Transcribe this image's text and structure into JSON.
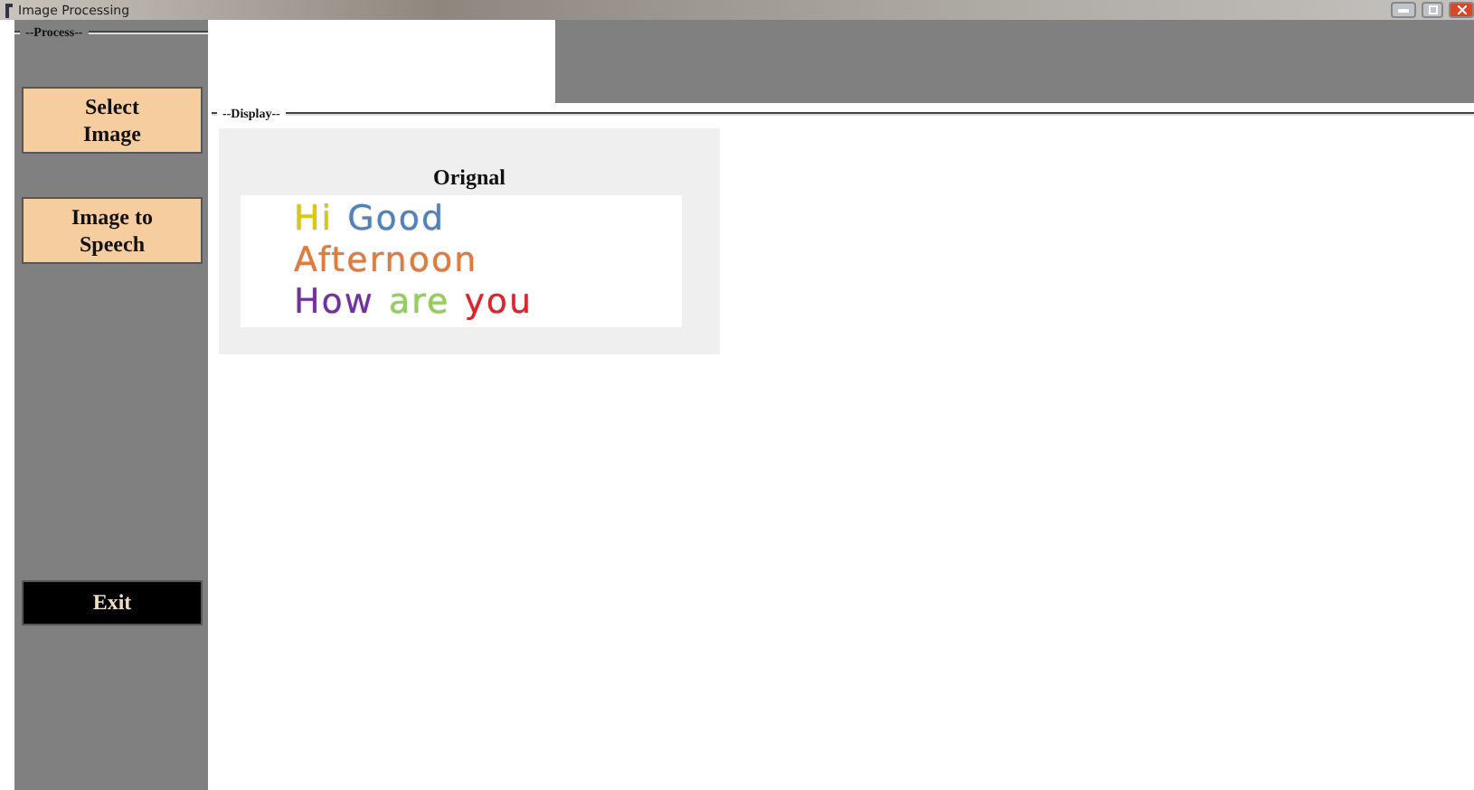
{
  "window": {
    "title": "Image Processing"
  },
  "process": {
    "legend": "--Process--",
    "buttons": [
      {
        "label": "Select Image",
        "kind": "action"
      },
      {
        "label": "Image to Speech",
        "kind": "action"
      },
      {
        "label": "Exit",
        "kind": "exit"
      }
    ]
  },
  "display": {
    "legend": "--Display--",
    "image_title": "Orignal",
    "image_lines": [
      [
        {
          "text": "Hi",
          "color": "#d8cc00"
        },
        {
          "text": "Good",
          "color": "#4f81bd"
        }
      ],
      [
        {
          "text": "Afternoon",
          "color": "#e07b39"
        }
      ],
      [
        {
          "text": "How",
          "color": "#7030a0"
        },
        {
          "text": "are",
          "color": "#92d050"
        },
        {
          "text": "you",
          "color": "#e0202a"
        }
      ]
    ]
  }
}
